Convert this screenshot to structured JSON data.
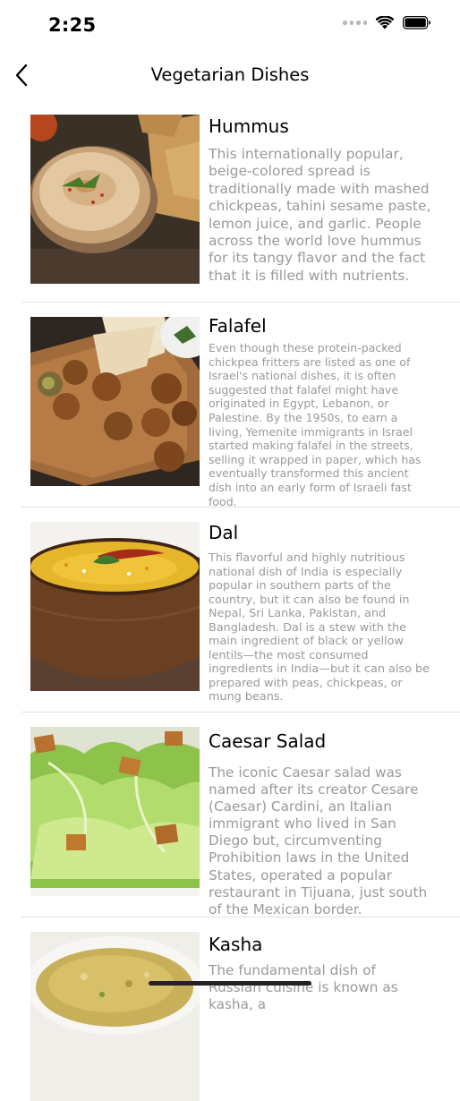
{
  "status_bar": {
    "time": "2:25"
  },
  "nav": {
    "title": "Vegetarian Dishes",
    "back_icon": "chevron-left-icon"
  },
  "dishes": [
    {
      "name": "Hummus",
      "image_icon": "hummus-photo",
      "description": "This internationally popular, beige-colored spread is traditionally made with mashed chickpeas, tahini sesame paste, lemon juice, and garlic. People across the world love hummus for its tangy flavor and the fact that it is filled with nutrients."
    },
    {
      "name": "Falafel",
      "image_icon": "falafel-photo",
      "description": "Even though these protein-packed chickpea fritters are listed as one of Israel's national dishes, it is often suggested that falafel might have originated in Egypt, Lebanon, or Palestine. By the 1950s, to earn a living, Yemenite immigrants in Israel started making falafel in the streets, selling it wrapped in paper, which has eventually transformed this ancient dish into an early form of Israeli fast food."
    },
    {
      "name": "Dal",
      "image_icon": "dal-photo",
      "description": "This flavorful and highly nutritious national dish of India is especially popular in southern parts of the country, but it can also be found in Nepal, Sri Lanka, Pakistan, and Bangladesh. Dal is a stew with the main ingredient of black or yellow lentils—the most consumed ingredients in India—but it can also be prepared with peas, chickpeas, or mung beans."
    },
    {
      "name": "Caesar Salad",
      "image_icon": "caesar-salad-photo",
      "description": "The iconic Caesar salad was named after its creator Cesare (Caesar) Cardini, an Italian immigrant who lived in San Diego but, circumventing Prohibition laws in the United States, operated a popular restaurant in Tijuana, just south of the Mexican border."
    },
    {
      "name": "Kasha",
      "image_icon": "kasha-photo",
      "description": "The fundamental dish of Russian cuisine is known as kasha, a"
    }
  ]
}
